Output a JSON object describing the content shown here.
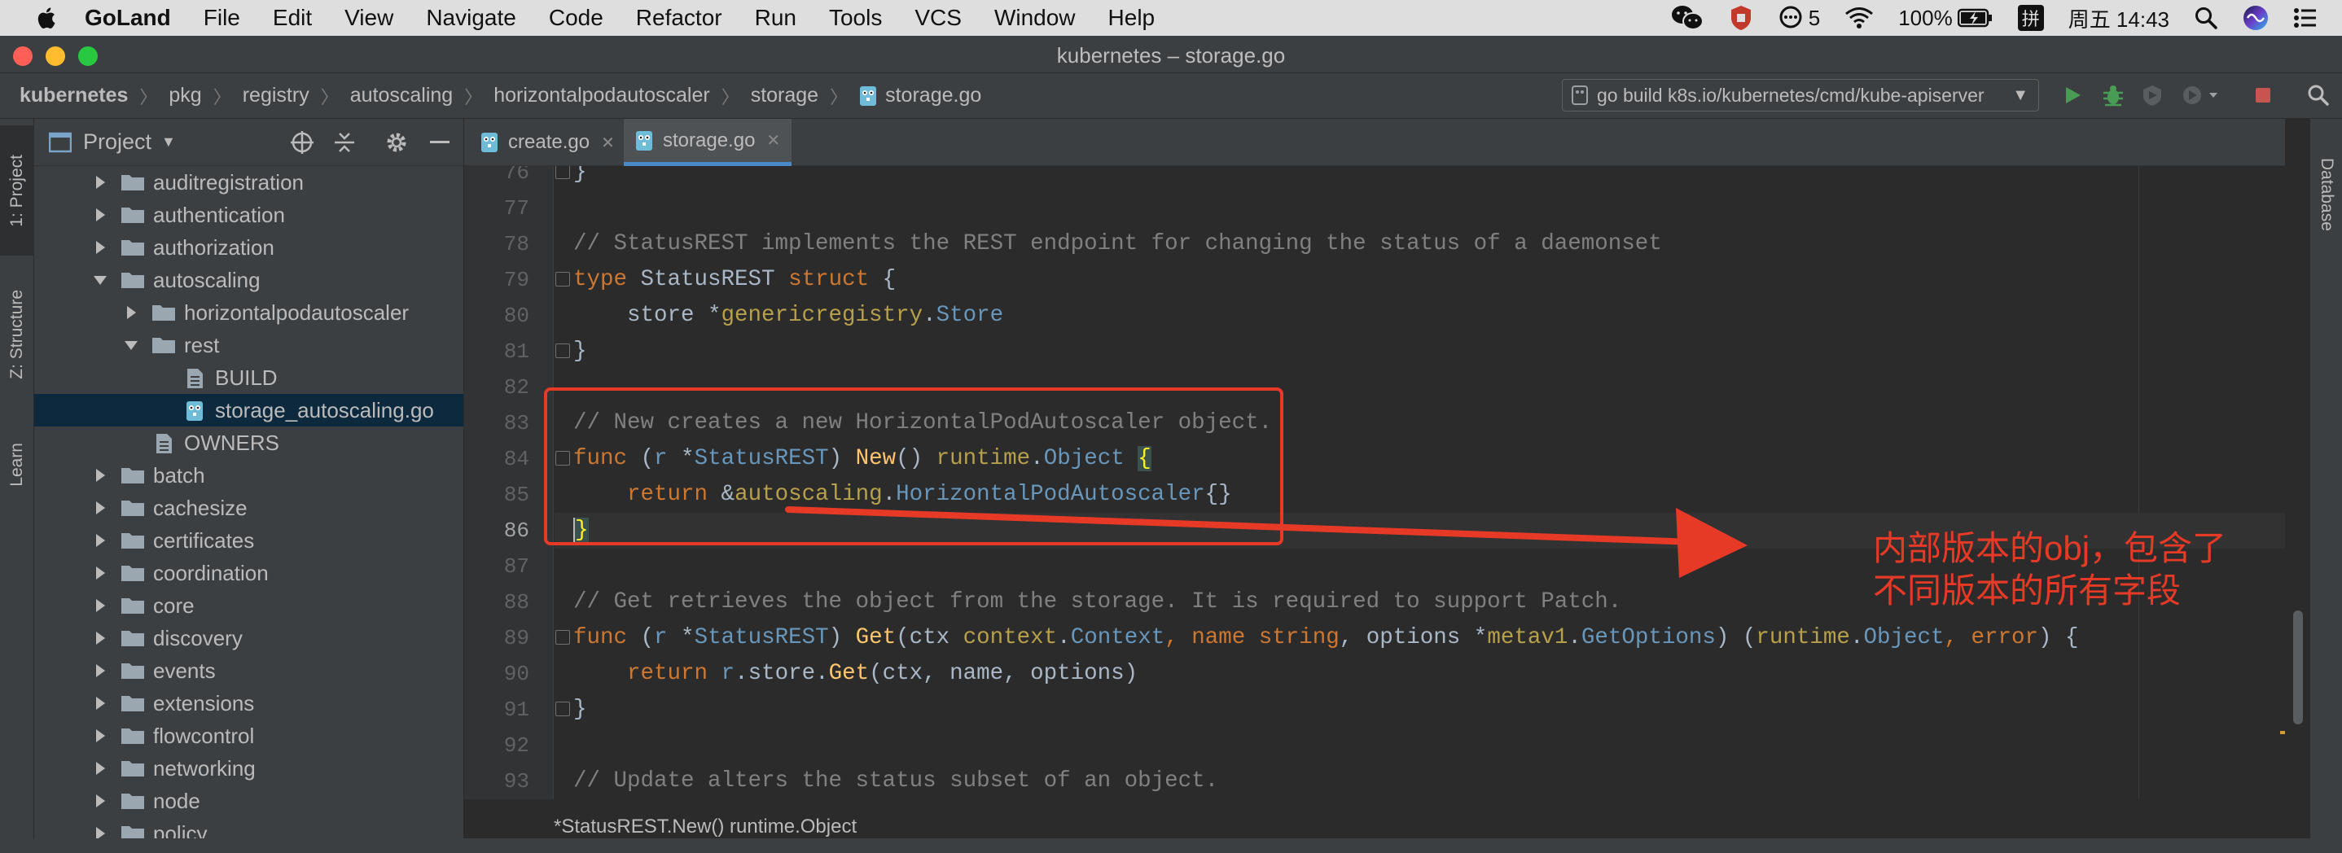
{
  "menubar": {
    "app_name": "GoLand",
    "items": [
      "File",
      "Edit",
      "View",
      "Navigate",
      "Code",
      "Refactor",
      "Run",
      "Tools",
      "VCS",
      "Window",
      "Help"
    ],
    "notification_count": "5",
    "battery": "100%",
    "input_method": "拼",
    "clock": "周五 14:43"
  },
  "window": {
    "title": "kubernetes – storage.go"
  },
  "breadcrumb": {
    "items": [
      "kubernetes",
      "pkg",
      "registry",
      "autoscaling",
      "horizontalpodautoscaler",
      "storage",
      "storage.go"
    ]
  },
  "run_config": {
    "label": "go build k8s.io/kubernetes/cmd/kube-apiserver"
  },
  "tool_windows": {
    "left": [
      "1: Project",
      "Z: Structure",
      "Learn"
    ],
    "right": [
      "Database"
    ]
  },
  "project_panel": {
    "title": "Project",
    "tree": [
      {
        "label": "auditregistration",
        "type": "folder",
        "expanded": false
      },
      {
        "label": "authentication",
        "type": "folder",
        "expanded": false
      },
      {
        "label": "authorization",
        "type": "folder",
        "expanded": false
      },
      {
        "label": "autoscaling",
        "type": "folder",
        "expanded": true
      },
      {
        "label": "horizontalpodautoscaler",
        "type": "folder",
        "expanded": false
      },
      {
        "label": "rest",
        "type": "folder",
        "expanded": true
      },
      {
        "label": "BUILD",
        "type": "file"
      },
      {
        "label": "storage_autoscaling.go",
        "type": "gofile",
        "selected": true
      },
      {
        "label": "OWNERS",
        "type": "file"
      },
      {
        "label": "batch",
        "type": "folder",
        "expanded": false
      },
      {
        "label": "cachesize",
        "type": "folder",
        "expanded": false
      },
      {
        "label": "certificates",
        "type": "folder",
        "expanded": false
      },
      {
        "label": "coordination",
        "type": "folder",
        "expanded": false
      },
      {
        "label": "core",
        "type": "folder",
        "expanded": false
      },
      {
        "label": "discovery",
        "type": "folder",
        "expanded": false
      },
      {
        "label": "events",
        "type": "folder",
        "expanded": false
      },
      {
        "label": "extensions",
        "type": "folder",
        "expanded": false
      },
      {
        "label": "flowcontrol",
        "type": "folder",
        "expanded": false
      },
      {
        "label": "networking",
        "type": "folder",
        "expanded": false
      },
      {
        "label": "node",
        "type": "folder",
        "expanded": false
      },
      {
        "label": "policy",
        "type": "folder",
        "expanded": false
      }
    ]
  },
  "editor_tabs": [
    {
      "label": "create.go",
      "active": false
    },
    {
      "label": "storage.go",
      "active": true
    }
  ],
  "editor": {
    "line_numbers": [
      "76",
      "77",
      "78",
      "79",
      "80",
      "81",
      "82",
      "83",
      "84",
      "85",
      "86",
      "87",
      "88",
      "89",
      "90",
      "91",
      "92",
      "93"
    ],
    "current_line": "86",
    "code": {
      "l76": "}",
      "l78": "// StatusREST implements the REST endpoint for changing the status of a daemonset",
      "l79_kw": "type",
      "l79_name": " StatusREST ",
      "l79_kw2": "struct",
      "l79_rest": " {",
      "l80_a": "    store *",
      "l80_pkg": "genericregistry",
      "l80_b": ".",
      "l80_ty": "Store",
      "l81": "}",
      "l83": "// New creates a new HorizontalPodAutoscaler object.",
      "l84_kw": "func",
      "l84_a": " (",
      "l84_r": "r",
      "l84_b": " *",
      "l84_recv": "StatusREST",
      "l84_c": ") ",
      "l84_fn": "New",
      "l84_d": "() ",
      "l84_pkg": "runtime",
      "l84_e": ".",
      "l84_ty": "Object",
      "l84_f": " ",
      "l84_brace": "{",
      "l85_a": "    ",
      "l85_kw": "return",
      "l85_b": " &",
      "l85_pkg": "autoscaling",
      "l85_c": ".",
      "l85_ty": "HorizontalPodAutoscaler",
      "l85_d": "{}",
      "l86": "}",
      "l88": "// Get retrieves the object from the storage. It is required to support Patch.",
      "l89_kw": "func",
      "l89_a": " (",
      "l89_r": "r",
      "l89_b": " *",
      "l89_recv": "StatusREST",
      "l89_c": ") ",
      "l89_fn": "Get",
      "l89_d": "(ctx ",
      "l89_pkg1": "context",
      "l89_e": ".",
      "l89_ty1": "Context",
      "l89_f": ", name ",
      "l89_ty2": "string",
      "l89_g": ", options *",
      "l89_pkg2": "metav1",
      "l89_h": ".",
      "l89_ty3": "GetOptions",
      "l89_i": ") (",
      "l89_pkg3": "runtime",
      "l89_j": ".",
      "l89_ty4": "Object",
      "l89_k": ", ",
      "l89_ty5": "error",
      "l89_l": ") {",
      "l90_a": "    ",
      "l90_kw": "return",
      "l90_b": " ",
      "l90_r": "r",
      "l90_c": ".store.",
      "l90_fn": "Get",
      "l90_d": "(ctx, name, options)",
      "l91": "}",
      "l93": "// Update alters the status subset of an object."
    }
  },
  "hint": {
    "text": "*StatusREST.New() runtime.Object"
  },
  "annotation": {
    "line1": "内部版本的obj，包含了",
    "line2": "不同版本的所有字段",
    "color": "#e63a27"
  },
  "colors": {
    "keyword": "#cc7832",
    "comment": "#808080",
    "type": "#6897bb",
    "function": "#ffc66d",
    "package": "#b7a04b"
  }
}
